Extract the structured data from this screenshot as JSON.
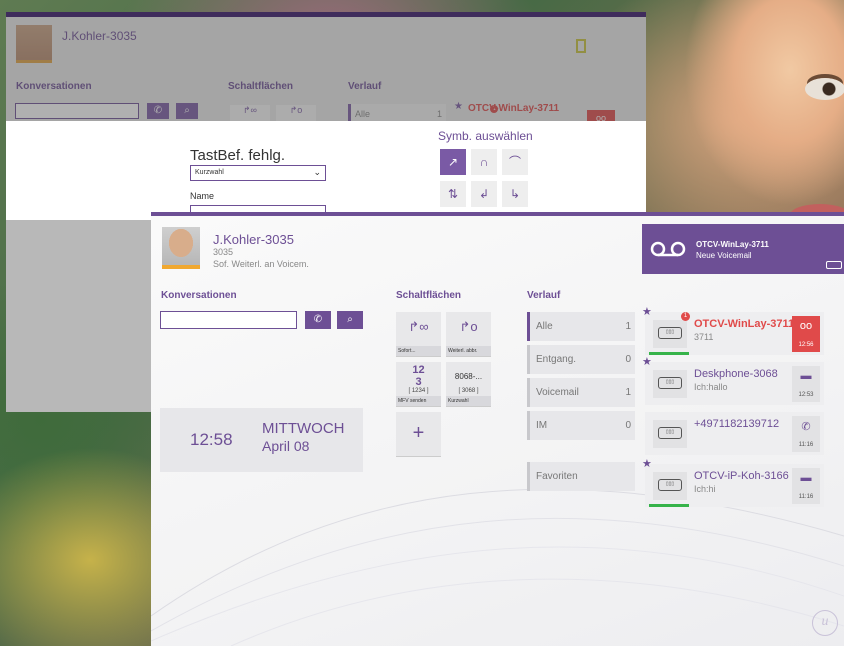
{
  "back_window": {
    "user_name": "J.Kohler-3035",
    "sections": {
      "conversations": "Konversationen",
      "buttons": "Schaltflächen",
      "history": "Verlauf"
    },
    "history_all": {
      "label": "Alle",
      "count": "1"
    },
    "contact_name": "OTCV-WinLay-3711",
    "badge": "1"
  },
  "dialog": {
    "title": "TastBef. fehlg.",
    "type_select": "Kurzwahl",
    "name_label": "Name",
    "symbol_title": "Symb. auswählen",
    "symbols": [
      "forward-icon",
      "headset-icon",
      "hangup-icon",
      "transfer-icon",
      "redirect-icon",
      "callback-icon"
    ]
  },
  "user": {
    "name": "J.Kohler-3035",
    "extension": "3035",
    "status": "Sof. Weiterl. an Voicem."
  },
  "notification": {
    "title": "OTCV-WinLay-3711",
    "message": "Neue Voicemail"
  },
  "sections": {
    "conversations": "Konversationen",
    "buttons": "Schaltflächen",
    "history": "Verlauf"
  },
  "clock": {
    "time": "12:58",
    "day": "MITTWOCH",
    "date": "April 08"
  },
  "buttons": [
    {
      "label": "Sofort...",
      "icon": "call-forward-icon"
    },
    {
      "label": "Weiterl. abbr.",
      "icon": "cancel-forward-icon"
    },
    {
      "label": "MFV senden",
      "line1": "12",
      "line2": "3",
      "number": "[ 1234 ]"
    },
    {
      "label": "Kurzwahl",
      "top": "8068-...",
      "number": "[ 3068 ]"
    }
  ],
  "add_button": "+",
  "history": [
    {
      "label": "Alle",
      "count": "1"
    },
    {
      "label": "Entgang.",
      "count": "0"
    },
    {
      "label": "Voicemail",
      "count": "1"
    },
    {
      "label": "IM",
      "count": "0"
    },
    {
      "label": "Favoriten",
      "count": ""
    }
  ],
  "conversations": [
    {
      "name": "OTCV-WinLay-3711",
      "sub": "3711",
      "time": "12:56",
      "badge": "1",
      "action_icon": "voicemail-icon"
    },
    {
      "name": "Deskphone-3068",
      "sub": "Ich:hallo",
      "time": "12:53",
      "action_icon": "chat-icon"
    },
    {
      "name": "+4971182139712",
      "sub": "",
      "time": "11:16",
      "action_icon": "phone-icon"
    },
    {
      "name": "OTCV-iP-Koh-3166",
      "sub": "Ich:hi",
      "time": "11:16",
      "action_icon": "chat-icon"
    }
  ],
  "colors": {
    "accent": "#6d4f95",
    "alert": "#e04a4a",
    "presence": "#36b34a"
  }
}
